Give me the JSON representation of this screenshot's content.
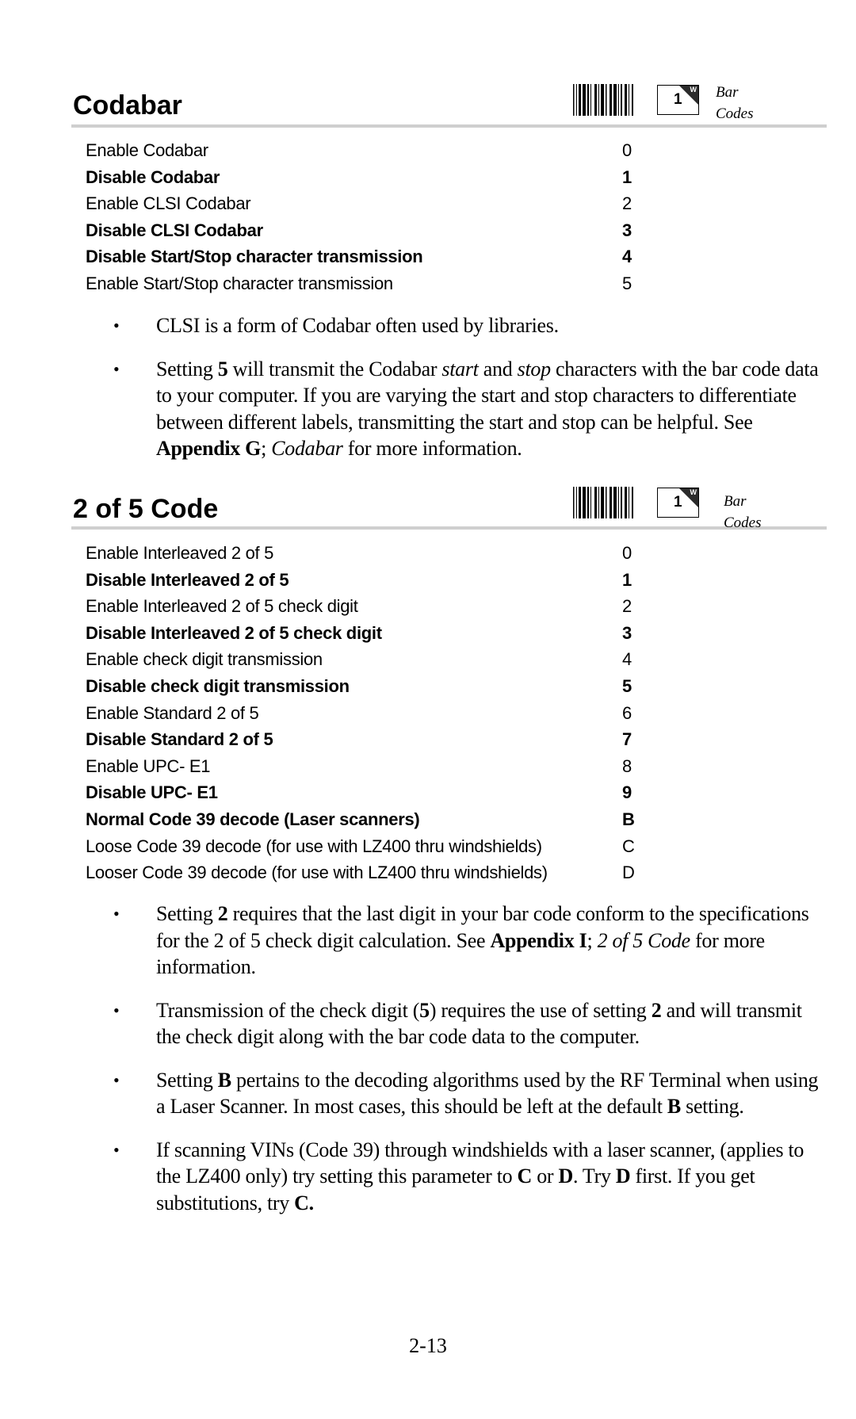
{
  "sections": [
    {
      "title": "Codabar",
      "badge": {
        "number": "1",
        "corner_letter": "W",
        "label_line1": "Bar",
        "label_line2": "Codes"
      },
      "options": [
        {
          "label": "Enable Codabar",
          "code": "0",
          "bold": false
        },
        {
          "label": "Disable Codabar",
          "code": "1",
          "bold": true
        },
        {
          "label": "Enable CLSI Codabar",
          "code": "2",
          "bold": false
        },
        {
          "label": "Disable CLSI Codabar",
          "code": "3",
          "bold": true
        },
        {
          "label": "Disable Start/Stop character transmission",
          "code": "4",
          "bold": true
        },
        {
          "label": "Enable Start/Stop character transmission",
          "code": "5",
          "bold": false
        }
      ],
      "notes": [
        [
          {
            "t": "CLSI is a form of Codabar often used by libraries."
          }
        ],
        [
          {
            "t": "Setting "
          },
          {
            "t": "5",
            "b": true
          },
          {
            "t": " will transmit the Codabar "
          },
          {
            "t": "start",
            "i": true
          },
          {
            "t": " and "
          },
          {
            "t": "stop",
            "i": true
          },
          {
            "t": " characters with the bar code data to your computer.  If you are varying the start and stop characters to differentiate between different labels, transmitting the start and stop can be helpful.  See "
          },
          {
            "t": "Appendix G",
            "b": true
          },
          {
            "t": "; "
          },
          {
            "t": "Codabar",
            "i": true
          },
          {
            "t": " for more information."
          }
        ]
      ]
    },
    {
      "title": "2 of 5 Code",
      "badge": {
        "number": "1",
        "corner_letter": "W",
        "label_line1": "Bar",
        "label_line2": "Codes"
      },
      "options": [
        {
          "label": "Enable Interleaved 2 of 5",
          "code": "0",
          "bold": false
        },
        {
          "label": "Disable Interleaved 2 of 5",
          "code": "1",
          "bold": true
        },
        {
          "label": "Enable Interleaved 2 of 5 check digit",
          "code": "2",
          "bold": false
        },
        {
          "label": "Disable Interleaved 2 of 5 check digit",
          "code": "3",
          "bold": true
        },
        {
          "label": "Enable check digit transmission",
          "code": "4",
          "bold": false
        },
        {
          "label": "Disable check digit transmission",
          "code": "5",
          "bold": true
        },
        {
          "label": "Enable Standard 2 of 5",
          "code": "6",
          "bold": false
        },
        {
          "label": "Disable Standard 2 of 5",
          "code": "7",
          "bold": true
        },
        {
          "label": "Enable UPC- E1",
          "code": "8",
          "bold": false
        },
        {
          "label": "Disable UPC- E1",
          "code": "9",
          "bold": true
        },
        {
          "label": "Normal Code 39 decode (Laser scanners)",
          "code": "B",
          "bold": true
        },
        {
          "label": "Loose Code 39 decode (for use with LZ400 thru windshields)",
          "code": "C",
          "bold": false
        },
        {
          "label": "Looser Code 39 decode (for use with LZ400 thru windshields)",
          "code": "D",
          "bold": false
        }
      ],
      "notes": [
        [
          {
            "t": "Setting "
          },
          {
            "t": "2",
            "b": true
          },
          {
            "t": " requires that the last digit in your bar code conform to the specifications for the 2 of 5 check digit calculation.  See "
          },
          {
            "t": "Appendix I",
            "b": true
          },
          {
            "t": "; "
          },
          {
            "t": "2 of 5 Code",
            "i": true
          },
          {
            "t": " for more information."
          }
        ],
        [
          {
            "t": "Transmission of the check digit ("
          },
          {
            "t": "5",
            "b": true
          },
          {
            "t": ") requires the use of setting "
          },
          {
            "t": "2",
            "b": true
          },
          {
            "t": " and will transmit the check digit along with the bar code data to the computer."
          }
        ],
        [
          {
            "t": "Setting "
          },
          {
            "t": "B",
            "b": true
          },
          {
            "t": " pertains to the decoding algorithms used by the RF Terminal when using a Laser Scanner. In most cases, this should be left at the default "
          },
          {
            "t": "B",
            "b": true
          },
          {
            "t": " setting."
          }
        ],
        [
          {
            "t": "If scanning VINs (Code 39) through windshields with a laser scanner, (applies to the LZ400 only) try setting this parameter to "
          },
          {
            "t": "C",
            "b": true
          },
          {
            "t": " or "
          },
          {
            "t": "D",
            "b": true
          },
          {
            "t": ". Try "
          },
          {
            "t": "D",
            "b": true
          },
          {
            "t": " first. If you get substitutions, try "
          },
          {
            "t": "C.",
            "b": true
          }
        ]
      ]
    }
  ],
  "icons": {
    "barcode": "barcode-icon",
    "badge": "bar-codes-badge-icon",
    "bullet": "bullet-icon"
  },
  "footer": {
    "page_number": "2-13"
  }
}
